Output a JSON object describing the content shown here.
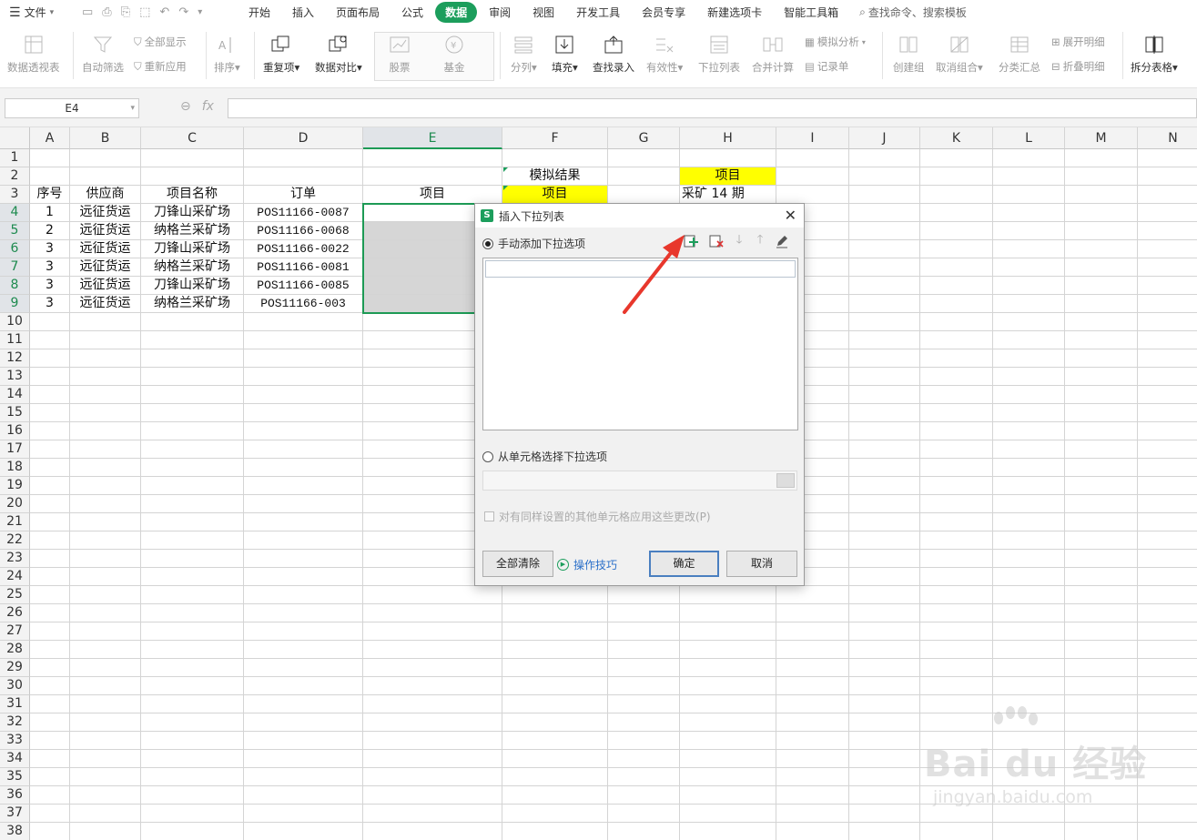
{
  "menubar": {
    "file_label": "文件",
    "tabs": [
      "开始",
      "插入",
      "页面布局",
      "公式",
      "数据",
      "审阅",
      "视图",
      "开发工具",
      "会员专享",
      "新建选项卡",
      "智能工具箱"
    ],
    "active_tab": "数据",
    "search_placeholder": "查找命令、搜索模板"
  },
  "ribbon": {
    "pivot": "数据透视表",
    "autofilter": "自动筛选",
    "show_all": "全部显示",
    "reapply": "重新应用",
    "sort": "排序",
    "duplicates": "重复项",
    "compare": "数据对比",
    "stocks": "股票",
    "funds": "基金",
    "split": "分列",
    "fill": "填充",
    "lookup": "查找录入",
    "validity": "有效性",
    "dropdown": "下拉列表",
    "consolidate": "合并计算",
    "simulate": "模拟分析",
    "record": "记录单",
    "group": "创建组",
    "ungroup": "取消组合",
    "subtotal": "分类汇总",
    "expand": "展开明细",
    "collapse": "折叠明细",
    "split_table": "拆分表格"
  },
  "formula_bar": {
    "name_box": "E4",
    "fx": "fx",
    "formula": ""
  },
  "sheet": {
    "columns": [
      "A",
      "B",
      "C",
      "D",
      "E",
      "F",
      "G",
      "H",
      "I",
      "J",
      "K",
      "L",
      "M",
      "N"
    ],
    "selected_column": "E",
    "selected_rows": [
      4,
      5,
      6,
      7,
      8,
      9
    ],
    "row_count": 38,
    "cells": {
      "F2": "模拟结果",
      "H2": "项目",
      "A3": "序号",
      "B3": "供应商",
      "C3": "项目名称",
      "D3": "订单",
      "E3": "项目",
      "F3": "项目",
      "H3": "采矿 14 期",
      "A4": "1",
      "B4": "远征货运",
      "C4": "刀锋山采矿场",
      "D4": "POS11166-0087",
      "A5": "2",
      "B5": "远征货运",
      "C5": "纳格兰采矿场",
      "D5": "POS11166-0068",
      "A6": "3",
      "B6": "远征货运",
      "C6": "刀锋山采矿场",
      "D6": "POS11166-0022",
      "A7": "3",
      "B7": "远征货运",
      "C7": "纳格兰采矿场",
      "D7": "POS11166-0081",
      "A8": "3",
      "B8": "远征货运",
      "C8": "刀锋山采矿场",
      "D8": "POS11166-0085",
      "A9": "3",
      "B9": "远征货运",
      "C9": "纳格兰采矿场",
      "D9": "POS11166-003"
    },
    "highlight_color": "#ffff00",
    "selection_color": "#1d9a55"
  },
  "dialog": {
    "title": "插入下拉列表",
    "option_manual": "手动添加下拉选项",
    "option_cells": "从单元格选择下拉选项",
    "apply_all": "对有同样设置的其他单元格应用这些更改(P)",
    "clear_all": "全部清除",
    "tips": "操作技巧",
    "ok": "确定",
    "cancel": "取消",
    "logo": "S"
  },
  "watermark": {
    "main": "Bai du 经验",
    "sub": "jingyan.baidu.com"
  }
}
